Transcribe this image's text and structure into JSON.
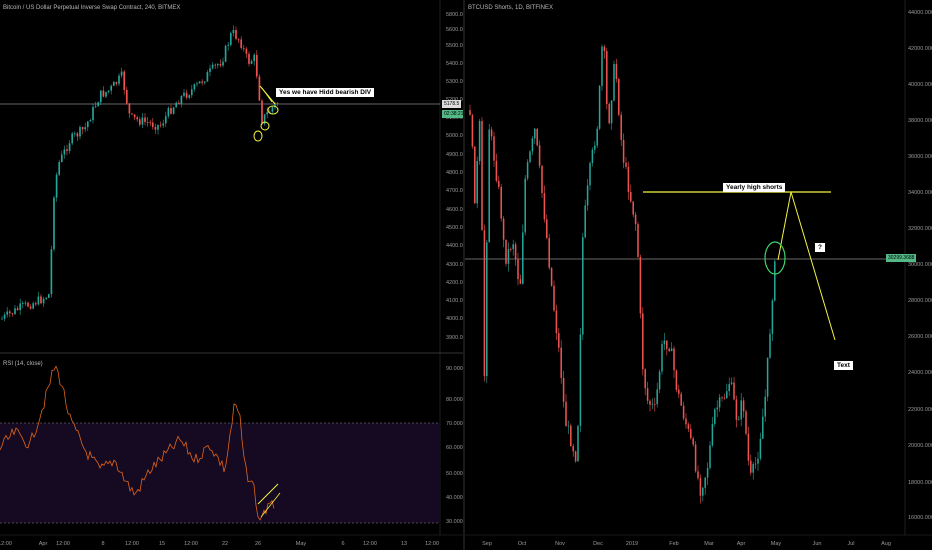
{
  "left": {
    "title": "Bitcoin / US Dollar Perpetual Inverse Swap Contract, 240, BITMEX",
    "y_ticks": [
      "5800.0",
      "5600.0",
      "5500.0",
      "5400.0",
      "5300.0",
      "5200.0",
      "5100.0",
      "5000.0",
      "4900.0",
      "4800.0",
      "4700.0",
      "4600.0",
      "4500.0",
      "4400.0",
      "4300.0",
      "4200.0",
      "4100.0",
      "4000.0",
      "3900.0"
    ],
    "x_ticks": [
      "12:00",
      "Apr",
      "12:00",
      "8",
      "12:00",
      "15",
      "12:00",
      "22",
      "26",
      "May",
      "6",
      "12:00",
      "13",
      "12:00"
    ],
    "price_label": "5178.5",
    "countdown_label": "02:38:21",
    "annotation": "Yes we have Hidd bearish DIV",
    "rsi_title": "RSI (14, close)",
    "rsi_ticks": [
      "90.0000",
      "80.0000",
      "70.0000",
      "60.0000",
      "50.0000",
      "40.0000",
      "30.0000"
    ]
  },
  "right": {
    "title": "BTCUSD Shorts, 1D, BITFINEX",
    "y_ticks": [
      "44000.0000",
      "42000.0000",
      "40000.0000",
      "38000.0000",
      "36000.0000",
      "34000.0000",
      "32000.0000",
      "30000.0000",
      "28000.0000",
      "26000.0000",
      "24000.0000",
      "22000.0000",
      "20000.0000",
      "18000.0000",
      "16000.0000"
    ],
    "x_ticks": [
      "Sep",
      "Oct",
      "Nov",
      "Dec",
      "2019",
      "Feb",
      "Mar",
      "Apr",
      "May",
      "Jun",
      "Jul",
      "Aug"
    ],
    "price_label": "30299.3688",
    "annotation_yearly": "Yearly  high shorts",
    "annotation_q": "?",
    "annotation_text": "Text"
  },
  "colors": {
    "up": "#26a69a",
    "down": "#ef5350",
    "rsi_line": "#e0641a",
    "annotation": "#f5f542",
    "price_box": "#53b987"
  }
}
